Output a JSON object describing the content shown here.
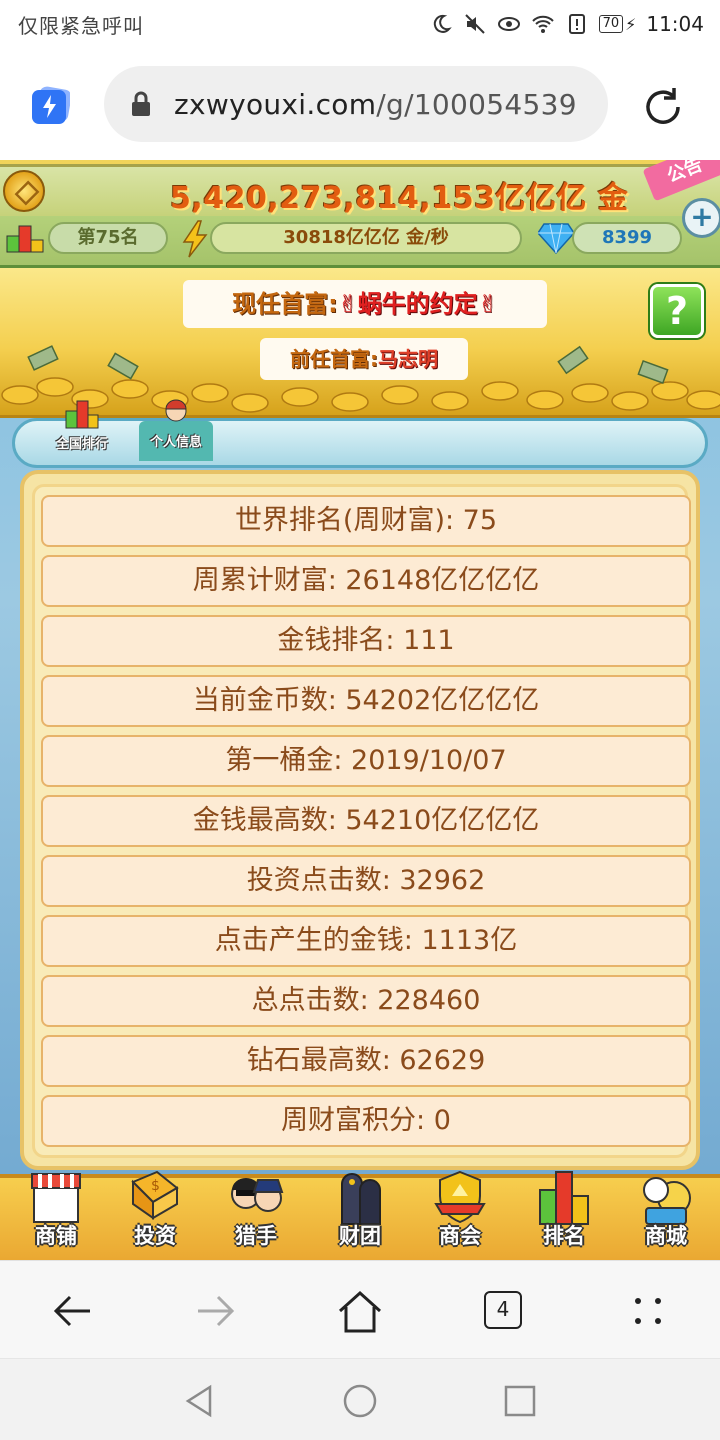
{
  "status_bar": {
    "carrier": "仅限紧急呼叫",
    "battery": "70",
    "time": "11:04"
  },
  "browser": {
    "url_domain": "zxwyouxi.com",
    "url_path": "/g/100054539",
    "tab_count": "4"
  },
  "game": {
    "gold_amount": "5,420,273,814,153亿亿亿 金",
    "rank_label": "第75名",
    "income_rate": "30818亿亿亿 金/秒",
    "diamonds": "8399",
    "gift_tag": "公告",
    "richest_label": "现任首富:",
    "richest_name": "✌蜗牛的约定✌",
    "prev_richest_label": "前任首富:",
    "prev_richest_name": "马志明",
    "help_symbol": "?",
    "tabs": [
      {
        "label": "全国排行"
      },
      {
        "label": "个人信息"
      }
    ],
    "stats": [
      "世界排名(周财富): 75",
      "周累计财富: 26148亿亿亿亿",
      "金钱排名: 111",
      "当前金币数: 54202亿亿亿亿",
      "第一桶金: 2019/10/07",
      "金钱最高数: 54210亿亿亿亿",
      "投资点击数: 32962",
      "点击产生的金钱: 1113亿",
      "总点击数: 228460",
      "钻石最高数: 62629",
      "周财富积分: 0"
    ],
    "menu": [
      {
        "label": "商铺",
        "icon": "shop-icon"
      },
      {
        "label": "投资",
        "icon": "invest-icon"
      },
      {
        "label": "猎手",
        "icon": "hunter-icon"
      },
      {
        "label": "财团",
        "icon": "consortium-icon"
      },
      {
        "label": "商会",
        "icon": "guild-icon"
      },
      {
        "label": "排名",
        "icon": "ranking-icon"
      },
      {
        "label": "商城",
        "icon": "mall-icon"
      }
    ]
  },
  "colors": {
    "gold_text": "#e25d10",
    "row_bg": "#fdebd4",
    "row_text": "#8a4b1b",
    "menu_bg": "#f7ce4e"
  }
}
